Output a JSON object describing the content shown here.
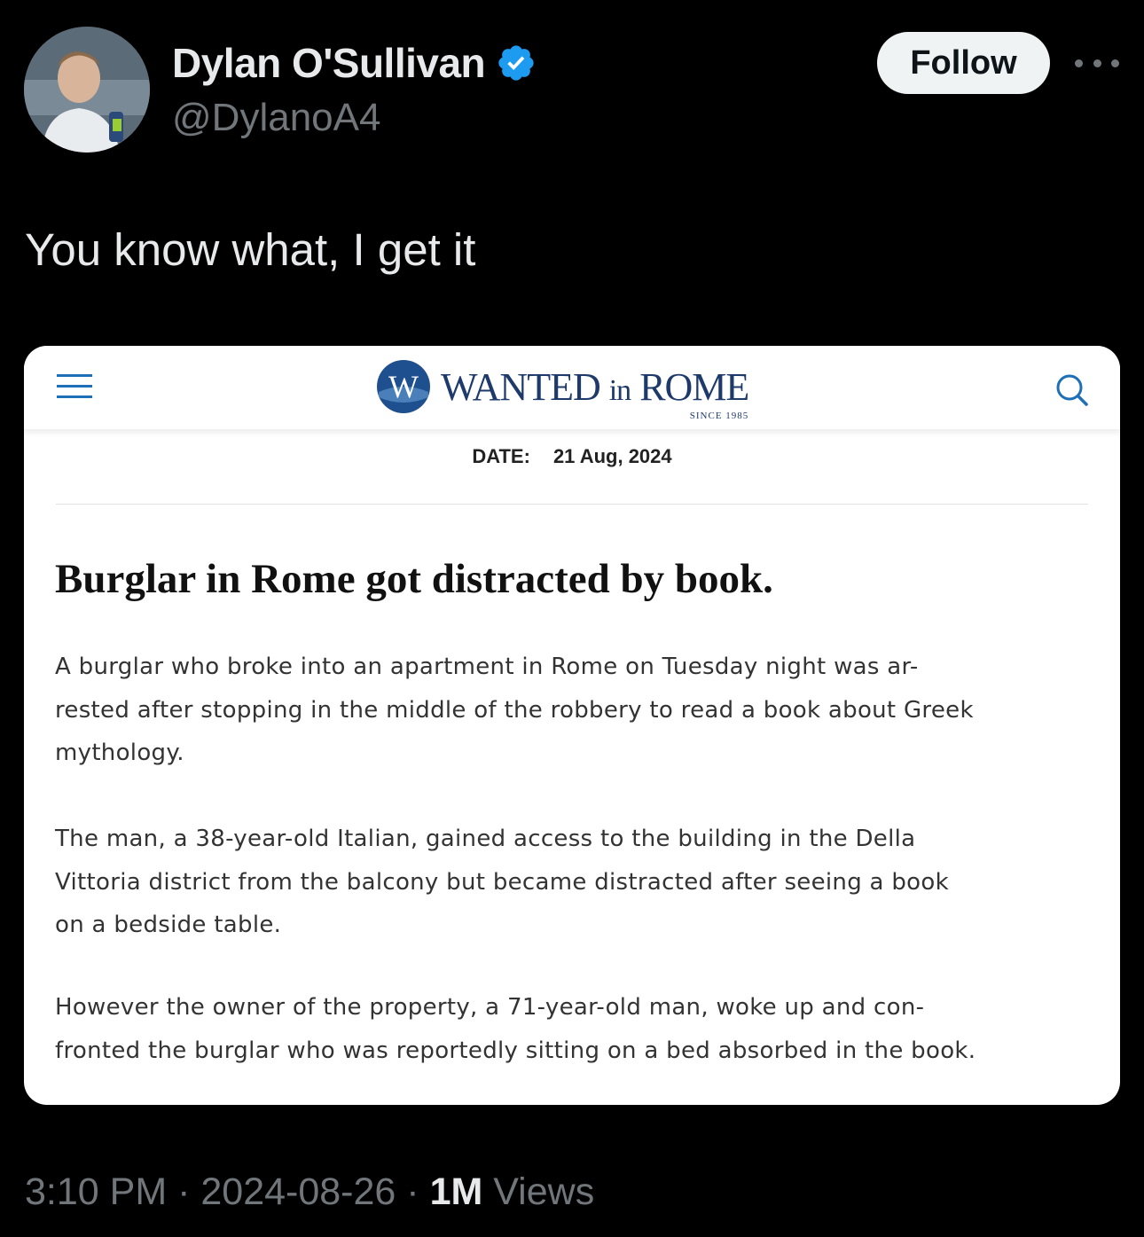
{
  "author": {
    "display_name": "Dylan O'Sullivan",
    "handle": "@DylanoA4",
    "verified": true
  },
  "actions": {
    "follow_label": "Follow",
    "more_icon": "more-horizontal-icon"
  },
  "tweet": {
    "text": "You know what, I get it"
  },
  "article": {
    "site": {
      "logo_letter": "W",
      "name_part1": "WANTED",
      "name_part2": "in",
      "name_part3": "ROME",
      "since": "SINCE 1985"
    },
    "date_label": "DATE:",
    "date_value": "21 Aug, 2024",
    "headline": "Burglar in Rome got distracted by book.",
    "paragraphs": [
      {
        "lines": [
          "A burglar who broke into an apartment in Rome on Tuesday night was ar-",
          "rested after stopping in the middle of the robbery to read a book about Greek",
          "mythology."
        ]
      },
      {
        "lines": [
          "The man, a 38-year-old Italian, gained access to the building in the Della",
          "Vittoria district from the balcony but became distracted after seeing a book",
          "on a bedside table."
        ]
      },
      {
        "lines": [
          "However the owner of the property, a 71-year-old man, woke up and con-",
          "fronted the burglar who was reportedly sitting on a bed absorbed in the book."
        ]
      }
    ]
  },
  "meta": {
    "time": "3:10 PM",
    "separator": "·",
    "date": "2024-08-26",
    "views_count": "1M",
    "views_label": "Views"
  },
  "colors": {
    "background": "#000000",
    "text_primary": "#e7e9ea",
    "text_secondary": "#71767b",
    "verified_blue": "#1d9bf0",
    "follow_bg": "#eff3f4",
    "logo_navy": "#1e3a6b"
  }
}
